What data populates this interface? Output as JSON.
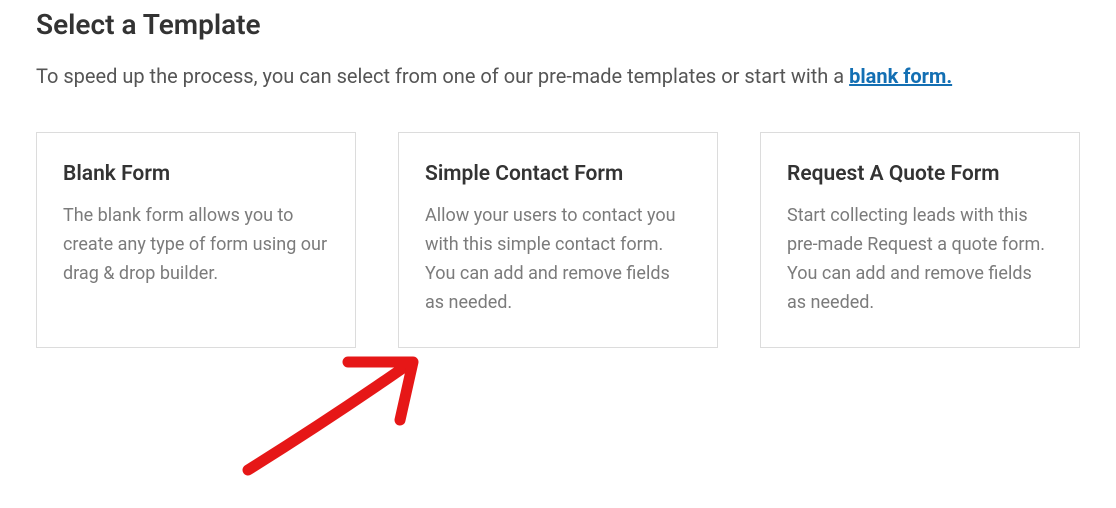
{
  "heading": "Select a Template",
  "lead_prefix": "To speed up the process, you can select from one of our pre-made templates or start with a ",
  "lead_link": "blank form.",
  "templates": [
    {
      "title": "Blank Form",
      "desc": "The blank form allows you to create any type of form using our drag & drop builder."
    },
    {
      "title": "Simple Contact Form",
      "desc": "Allow your users to contact you with this simple contact form. You can add and remove fields as needed."
    },
    {
      "title": "Request A Quote Form",
      "desc": "Start collecting leads with this pre-made Request a quote form. You can add and remove fields as needed."
    }
  ]
}
